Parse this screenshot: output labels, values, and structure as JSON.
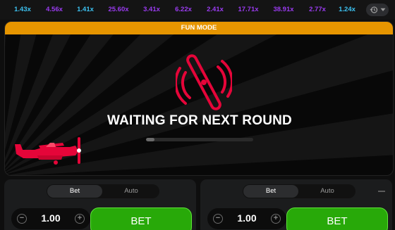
{
  "history": {
    "multipliers": [
      {
        "value": "1.43x",
        "color": "#3cc1f0"
      },
      {
        "value": "4.56x",
        "color": "#9a3bf0"
      },
      {
        "value": "1.41x",
        "color": "#3cc1f0"
      },
      {
        "value": "25.60x",
        "color": "#9a3bf0"
      },
      {
        "value": "3.41x",
        "color": "#9a3bf0"
      },
      {
        "value": "6.22x",
        "color": "#9a3bf0"
      },
      {
        "value": "2.41x",
        "color": "#9a3bf0"
      },
      {
        "value": "17.71x",
        "color": "#9a3bf0"
      },
      {
        "value": "38.91x",
        "color": "#9a3bf0"
      },
      {
        "value": "2.77x",
        "color": "#9a3bf0"
      },
      {
        "value": "1.24x",
        "color": "#3cc1f0"
      }
    ],
    "toggle_icon": "history-clock-icon"
  },
  "game": {
    "mode_banner": "FUN MODE",
    "status_text": "WAITING FOR NEXT ROUND",
    "progress": 0.08,
    "accent_color": "#e50539",
    "banner_color": "#e69500"
  },
  "bet_panels": [
    {
      "tabs": [
        "Bet",
        "Auto"
      ],
      "active_tab": "Bet",
      "amount": "1.00",
      "bet_label": "BET",
      "show_remove": false
    },
    {
      "tabs": [
        "Bet",
        "Auto"
      ],
      "active_tab": "Bet",
      "amount": "1.00",
      "bet_label": "BET",
      "show_remove": true
    }
  ],
  "colors": {
    "bet_button": "#28a909",
    "multiplier_low": "#3cc1f0",
    "multiplier_mid": "#9a3bf0"
  }
}
